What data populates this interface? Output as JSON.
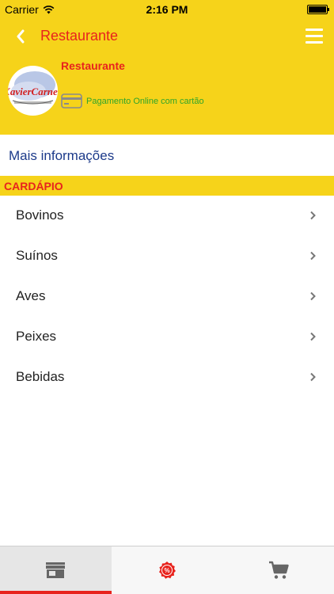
{
  "status_bar": {
    "carrier": "Carrier",
    "time": "2:16 PM",
    "battery_level": 1.0
  },
  "nav": {
    "title": "Restaurante",
    "back_icon": "chevron-left-icon",
    "menu_icon": "hamburger-menu-icon"
  },
  "restaurant": {
    "name": "Restaurante",
    "logo_text": "XavierCarnes",
    "payment_icon": "credit-card-icon",
    "payment_text": "Pagamento Online com cartão"
  },
  "more_info": {
    "label": "Mais informações"
  },
  "menu_section": {
    "title": "CARDÁPIO",
    "items": [
      {
        "label": "Bovinos"
      },
      {
        "label": "Suínos"
      },
      {
        "label": "Aves"
      },
      {
        "label": "Peixes"
      },
      {
        "label": "Bebidas"
      }
    ]
  },
  "tab_bar": {
    "tabs": [
      {
        "icon": "store-icon",
        "active": true
      },
      {
        "icon": "discount-badge-icon",
        "active": false
      },
      {
        "icon": "shopping-cart-icon",
        "active": false
      }
    ]
  },
  "colors": {
    "brand_yellow": "#f6d31a",
    "accent_red": "#e8231d",
    "link_blue": "#1c3a8a",
    "payment_green": "#2fa52a"
  }
}
